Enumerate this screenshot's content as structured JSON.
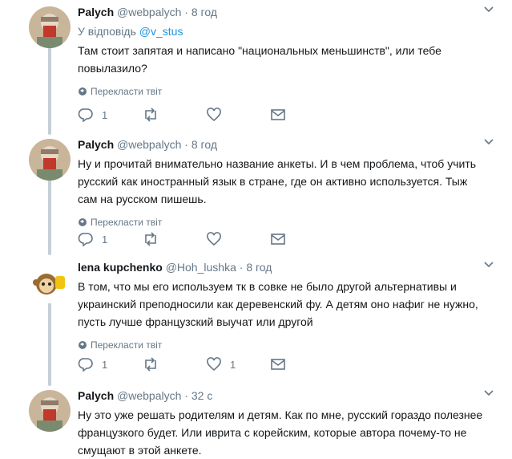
{
  "tweets": [
    {
      "name": "Palych",
      "handle": "@webpalych",
      "time": "8 год",
      "reply_to_prefix": "У відповідь",
      "reply_to_user": "@v_stus",
      "text": "Там стоит запятая и написано \"национальных меньшинств\", или тебе\nповылазило?",
      "translate": "Перекласти твіт",
      "reply_count": "1",
      "retweet_count": "",
      "like_count": ""
    },
    {
      "name": "Palych",
      "handle": "@webpalych",
      "time": "8 год",
      "text": "Ну и прочитай внимательно название анкеты. И в чем проблема, чтоб учить\nрусский как иностранный язык в стране, где он активно используется. Тыж\nсам на русском пишешь.",
      "translate": "Перекласти твіт",
      "reply_count": "1",
      "retweet_count": "",
      "like_count": ""
    },
    {
      "name": "lena kupchenko",
      "handle": "@Hoh_lushka",
      "time": "8 год",
      "text": "В том, что мы его используем тк в совке не было другой альтернативы и\nукраинский преподносили как деревенский фу. А детям оно нафиг не нужно,\nпусть лучше французский выучат или другой",
      "translate": "Перекласти твіт",
      "reply_count": "1",
      "retweet_count": "",
      "like_count": "1"
    },
    {
      "name": "Palych",
      "handle": "@webpalych",
      "time": "32 с",
      "text": "Ну это уже решать родителям и детям. Как по мне, русский гораздо полезнее\nфранцузкого будет. Или иврита с корейским, которые автора почему-то не\nсмущают в этой анкете."
    }
  ],
  "separator": "·",
  "colors": {
    "muted": "#657786",
    "link": "#1b95e0",
    "thread_line": "#c4cfd6"
  }
}
